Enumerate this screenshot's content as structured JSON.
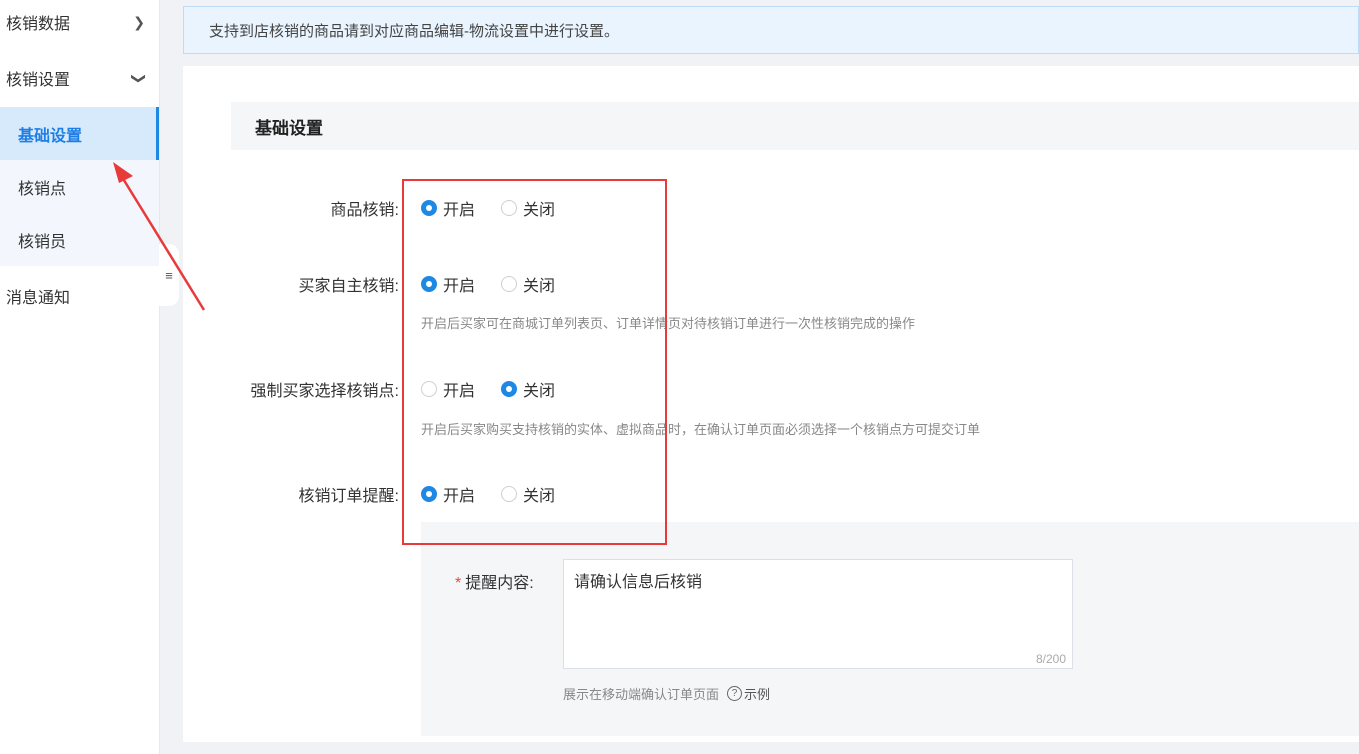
{
  "sidebar": {
    "groups": [
      {
        "label": "核销数据"
      },
      {
        "label": "核销设置"
      },
      {
        "label": "消息通知"
      }
    ],
    "submenu": [
      {
        "label": "基础设置"
      },
      {
        "label": "核销点"
      },
      {
        "label": "核销员"
      }
    ],
    "collapse_icon": "≡"
  },
  "notice": "支持到店核销的商品请到对应商品编辑-物流设置中进行设置。",
  "section_title": "基础设置",
  "settings": [
    {
      "label": "商品核销:",
      "on": "开启",
      "off": "关闭",
      "selected": "开启"
    },
    {
      "label": "买家自主核销:",
      "on": "开启",
      "off": "关闭",
      "selected": "开启",
      "hint": "开启后买家可在商城订单列表页、订单详情页对待核销订单进行一次性核销完成的操作"
    },
    {
      "label": "强制买家选择核销点:",
      "on": "开启",
      "off": "关闭",
      "selected": "关闭",
      "hint": "开启后买家购买支持核销的实体、虚拟商品时，在确认订单页面必须选择一个核销点方可提交订单"
    },
    {
      "label": "核销订单提醒:",
      "on": "开启",
      "off": "关闭",
      "selected": "开启"
    }
  ],
  "reminder": {
    "label": "提醒内容:",
    "required_mark": "*",
    "value": "请确认信息后核销",
    "counter": "8/200",
    "helper": "展示在移动端确认订单页面",
    "example_icon": "?",
    "example": "示例"
  },
  "colors": {
    "accent": "#1e88e5",
    "annotation": "#e83a3a"
  }
}
